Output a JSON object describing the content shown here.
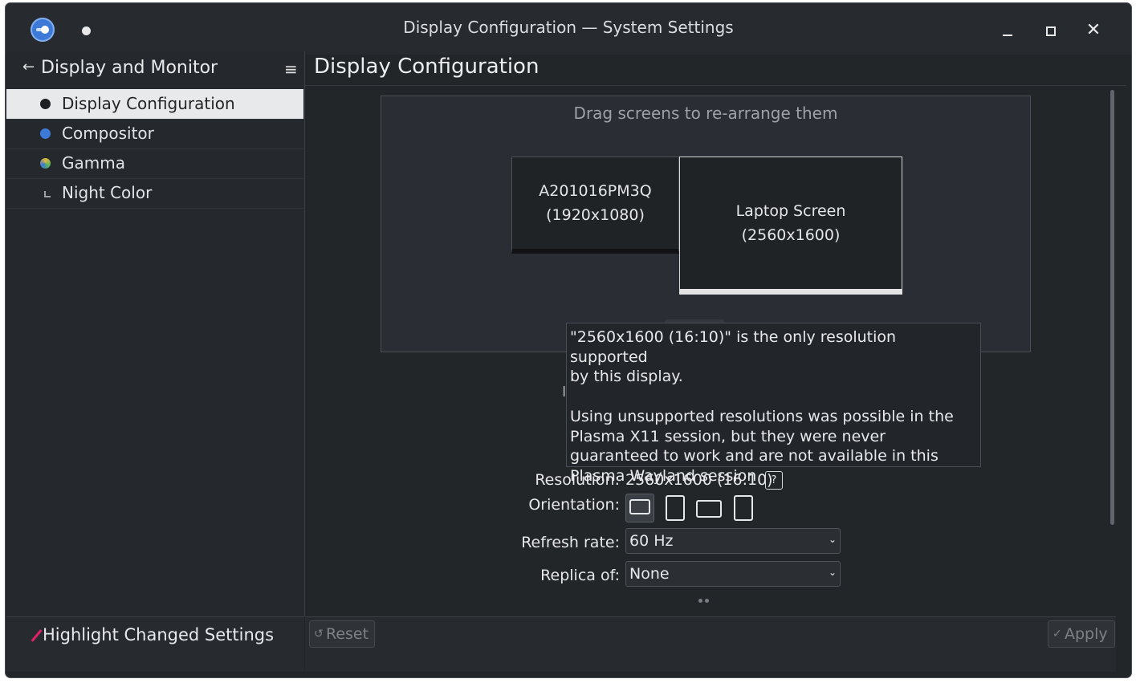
{
  "window": {
    "title": "Display Configuration — System Settings"
  },
  "sidebar": {
    "title": "Display and Monitor",
    "items": [
      {
        "label": "Display Configuration",
        "icon": "display-icon",
        "color": "#1d1f22"
      },
      {
        "label": "Compositor",
        "icon": "compositor-icon",
        "color": "#3d79d6"
      },
      {
        "label": "Gamma",
        "icon": "gamma-icon",
        "color": "#e5b83a"
      },
      {
        "label": "Night Color",
        "icon": "night-color-icon",
        "color": "#9aa0a6"
      }
    ],
    "footer": {
      "label": "Highlight Changed Settings"
    }
  },
  "main": {
    "title": "Display Configuration",
    "drag_hint": "Drag screens to re-arrange them",
    "screens": [
      {
        "name": "A201016PM3Q",
        "resolution": "(1920x1080)"
      },
      {
        "name": "Laptop Screen",
        "resolution": "(2560x1600)"
      }
    ],
    "tooltip": "\"2560x1600 (16:10)\" is the only resolution supported\nby this display.\n\nUsing unsupported resolutions was possible in the\nPlasma X11 session, but they were never\nguaranteed to work and are not available in this\nPlasma Wayland session.",
    "peek_char": "I",
    "resolution": {
      "label": "Resolution:",
      "value": "2560x1600 (16:10)",
      "help": "?"
    },
    "orientation": {
      "label": "Orientation:"
    },
    "refresh_rate": {
      "label": "Refresh rate:",
      "value": "60 Hz"
    },
    "replica_of": {
      "label": "Replica of:",
      "value": "None"
    }
  },
  "buttons": {
    "reset": "Reset",
    "apply": "Apply"
  },
  "colors": {
    "accent": "#3d79d6",
    "highlight": "#e0206a"
  }
}
